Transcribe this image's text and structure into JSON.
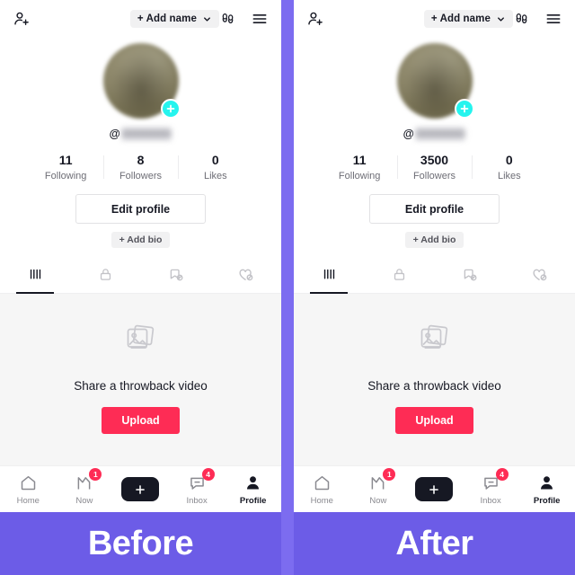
{
  "banner": {
    "before_label": "Before",
    "after_label": "After",
    "color": "#6c5ce7",
    "divider_color": "#7c6cf0"
  },
  "topbar": {
    "add_person_icon": "add-person-icon",
    "name_pill_label": "+ Add name",
    "chevron_icon": "chevron-down-icon",
    "discover_icon": "footsteps-icon",
    "menu_icon": "hamburger-menu-icon"
  },
  "profile": {
    "avatar_add_icon": "plus-icon",
    "handle_prefix": "@",
    "handle_blurred": "••••••••••••",
    "edit_profile_label": "Edit profile",
    "add_bio_label": "+ Add bio"
  },
  "stats_before": [
    {
      "value": "11",
      "label": "Following"
    },
    {
      "value": "8",
      "label": "Followers"
    },
    {
      "value": "0",
      "label": "Likes"
    }
  ],
  "stats_after": [
    {
      "value": "11",
      "label": "Following"
    },
    {
      "value": "3500",
      "label": "Followers"
    },
    {
      "value": "0",
      "label": "Likes"
    }
  ],
  "tabs": [
    {
      "icon": "grid-icon",
      "active": true
    },
    {
      "icon": "lock-icon",
      "active": false
    },
    {
      "icon": "bookmark-hidden-icon",
      "active": false
    },
    {
      "icon": "heart-hidden-icon",
      "active": false
    }
  ],
  "empty_state": {
    "icon": "photo-stack-icon",
    "text": "Share a throwback video",
    "upload_label": "Upload",
    "upload_color": "#fe2c55"
  },
  "bottom_nav": [
    {
      "label": "Home",
      "icon": "home-icon",
      "badge": "",
      "active": false
    },
    {
      "label": "Now",
      "icon": "now-icon",
      "badge": "1",
      "active": false
    },
    {
      "label": "",
      "icon": "create-plus-icon",
      "badge": "",
      "active": false
    },
    {
      "label": "Inbox",
      "icon": "inbox-icon",
      "badge": "4",
      "active": false
    },
    {
      "label": "Profile",
      "icon": "profile-person-icon",
      "badge": "",
      "active": true
    }
  ],
  "accent": {
    "cyan": "#25f4ee",
    "pink": "#fe2c55",
    "dark": "#161823"
  }
}
